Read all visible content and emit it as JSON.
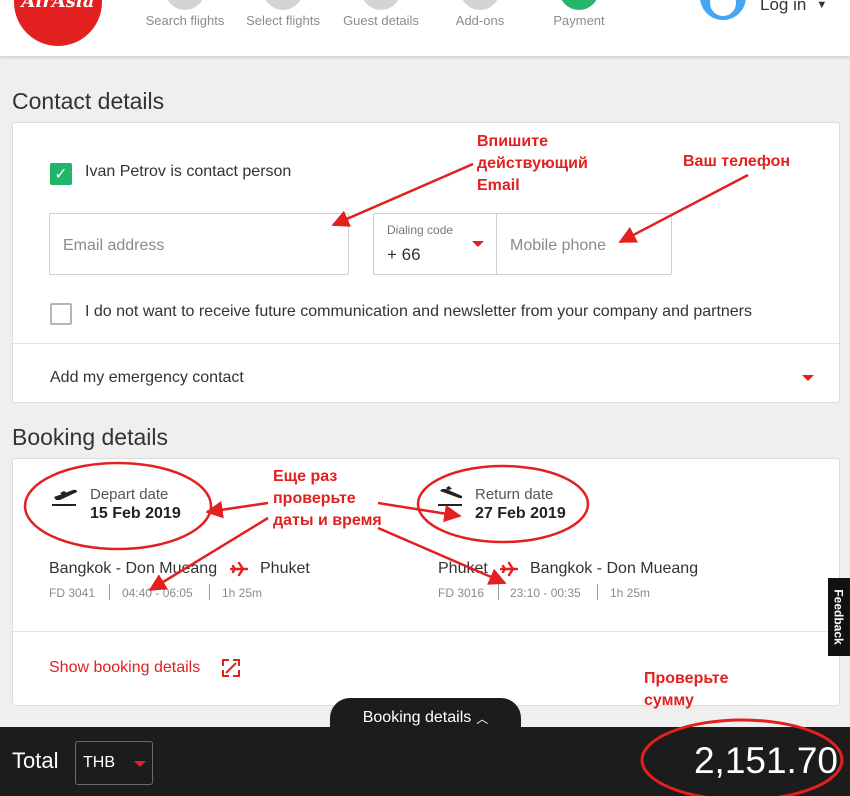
{
  "header": {
    "logo_text": "AirAsia",
    "steps": [
      {
        "label": "Search flights"
      },
      {
        "label": "Select flights"
      },
      {
        "label": "Guest details"
      },
      {
        "label": "Add-ons"
      },
      {
        "label": "Payment"
      }
    ],
    "login_label": "Log in"
  },
  "contact": {
    "title": "Contact details",
    "contact_person_label": "Ivan Petrov is contact person",
    "email_placeholder": "Email address",
    "dialing_code_label": "Dialing code",
    "dialing_code_value": "+ 66",
    "mobile_placeholder": "Mobile phone",
    "newsletter_label": "I do not want to receive future communication and newsletter from your company and partners",
    "emergency_label": "Add my emergency contact"
  },
  "booking": {
    "title": "Booking details",
    "depart": {
      "label": "Depart date",
      "date": "15 Feb 2019",
      "origin": "Bangkok - Don Mueang",
      "destination": "Phuket",
      "flight_no": "FD 3041",
      "time": "04:40 - 06:05",
      "duration": "1h 25m"
    },
    "return": {
      "label": "Return date",
      "date": "27 Feb 2019",
      "origin": "Phuket",
      "destination": "Bangkok - Don Mueang",
      "flight_no": "FD 3016",
      "time": "23:10 - 00:35",
      "duration": "1h 25m"
    },
    "show_details_link": "Show booking details"
  },
  "footer": {
    "tab_label": "Booking details",
    "total_label": "Total",
    "currency": "THB",
    "amount": "2,151.70"
  },
  "feedback_label": "Feedback",
  "annotations": {
    "email_line1": "Впишите",
    "email_line2": "действующий",
    "email_line3": "Email",
    "phone": "Ваш телефон",
    "dates_line1": "Еще раз",
    "dates_line2": "проверьте",
    "dates_line3": "даты и время",
    "sum_line1": "Проверьте",
    "sum_line2": "сумму"
  },
  "colors": {
    "brand_red": "#e1201f",
    "check_green": "#1fb56b",
    "footer_dark": "#1c1c1c"
  }
}
